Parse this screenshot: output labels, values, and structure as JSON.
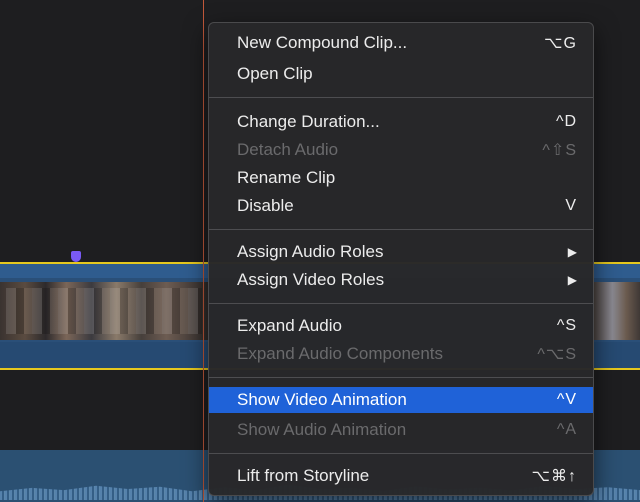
{
  "menu": {
    "items": [
      {
        "label": "New Compound Clip...",
        "shortcut": "⌥G",
        "enabled": true,
        "highlighted": false
      },
      {
        "label": "Open Clip",
        "shortcut": "",
        "enabled": true,
        "highlighted": false
      },
      {
        "label": "Change Duration...",
        "shortcut": "^D",
        "enabled": true,
        "highlighted": false
      },
      {
        "label": "Detach Audio",
        "shortcut": "^⇧S",
        "enabled": false,
        "highlighted": false
      },
      {
        "label": "Rename Clip",
        "shortcut": "",
        "enabled": true,
        "highlighted": false
      },
      {
        "label": "Disable",
        "shortcut": "V",
        "enabled": true,
        "highlighted": false
      },
      {
        "label": "Assign Audio Roles",
        "shortcut": "▶",
        "enabled": true,
        "highlighted": false
      },
      {
        "label": "Assign Video Roles",
        "shortcut": "▶",
        "enabled": true,
        "highlighted": false
      },
      {
        "label": "Expand Audio",
        "shortcut": "^S",
        "enabled": true,
        "highlighted": false
      },
      {
        "label": "Expand Audio Components",
        "shortcut": "^⌥S",
        "enabled": false,
        "highlighted": false
      },
      {
        "label": "Show Video Animation",
        "shortcut": "^V",
        "enabled": true,
        "highlighted": true
      },
      {
        "label": "Show Audio Animation",
        "shortcut": "^A",
        "enabled": false,
        "highlighted": false
      },
      {
        "label": "Lift from Storyline",
        "shortcut": "⌥⌘↑",
        "enabled": true,
        "highlighted": false
      }
    ]
  },
  "colors": {
    "highlight": "#1f62d8",
    "clip_border": "#e6c81e",
    "playhead": "#c2583a",
    "marker": "#7a5af5"
  }
}
